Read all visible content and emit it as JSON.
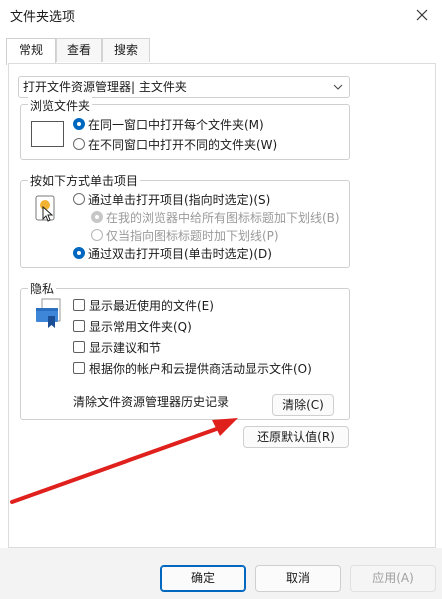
{
  "window": {
    "title": "文件夹选项",
    "close_icon": "close-icon"
  },
  "tabs": [
    {
      "label": "常规",
      "active": true
    },
    {
      "label": "查看",
      "active": false
    },
    {
      "label": "搜索",
      "active": false
    }
  ],
  "open_explorer": {
    "value": "打开文件资源管理器| 主文件夹"
  },
  "browse": {
    "legend": "浏览文件夹",
    "opt_same": "在同一窗口中打开每个文件夹(M)",
    "opt_diff": "在不同窗口中打开不同的文件夹(W)",
    "selected": "same"
  },
  "click": {
    "legend": "按如下方式单击项目",
    "opt_single": "通过单击打开项目(指向时选定)(S)",
    "sub_browser": "在我的浏览器中给所有图标标题加下划线(B)",
    "sub_point": "仅当指向图标标题时加下划线(P)",
    "opt_double": "通过双击打开项目(单击时选定)(D)",
    "selected": "double"
  },
  "privacy": {
    "legend": "隐私",
    "items": [
      "显示最近使用的文件(E)",
      "显示常用文件夹(Q)",
      "显示建议和节",
      "根据你的帐户和云提供商活动显示文件(O)"
    ],
    "clear_label": "清除文件资源管理器历史记录",
    "clear_button": "清除(C)"
  },
  "restore_button": "还原默认值(R)",
  "footer": {
    "ok": "确定",
    "cancel": "取消",
    "apply": "应用(A)"
  },
  "colors": {
    "accent": "#0067c0",
    "annotation_arrow": "#e0201c"
  }
}
